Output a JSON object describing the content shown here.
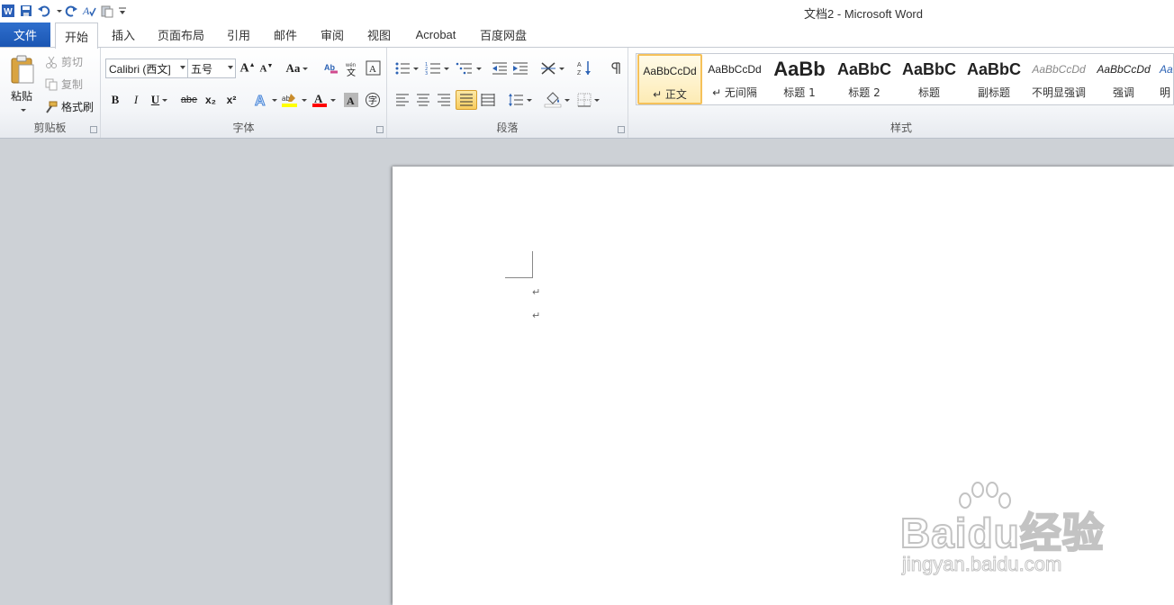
{
  "window": {
    "doc_name": "文档2",
    "separator": " - ",
    "app_name": "Microsoft Word"
  },
  "qat": {
    "icons": [
      "word-logo-icon",
      "save-icon",
      "undo-icon",
      "redo-icon",
      "spelling-icon",
      "paste-icon",
      "customize-qat-icon"
    ]
  },
  "tabs": {
    "file": "文件",
    "items": [
      {
        "label": "开始",
        "active": true
      },
      {
        "label": "插入"
      },
      {
        "label": "页面布局"
      },
      {
        "label": "引用"
      },
      {
        "label": "邮件"
      },
      {
        "label": "审阅"
      },
      {
        "label": "视图"
      },
      {
        "label": "Acrobat"
      },
      {
        "label": "百度网盘"
      }
    ]
  },
  "clipboard": {
    "paste": "粘贴",
    "cut": "剪切",
    "copy": "复制",
    "format_painter": "格式刷",
    "group_label": "剪贴板"
  },
  "font": {
    "font_name": "Calibri (西文]",
    "font_size": "五号",
    "case_label": "Aa",
    "bold": "B",
    "italic": "I",
    "underline": "U",
    "strikethrough": "abe",
    "subscript": "x₂",
    "superscript": "x²",
    "group_label": "字体"
  },
  "paragraph": {
    "group_label": "段落"
  },
  "styles": {
    "group_label": "样式",
    "items": [
      {
        "preview": "AaBbCcDd",
        "name": "↵ 正文"
      },
      {
        "preview": "AaBbCcDd",
        "name": "↵ 无间隔"
      },
      {
        "preview": "AaBb",
        "name": "标题 1"
      },
      {
        "preview": "AaBbC",
        "name": "标题 2"
      },
      {
        "preview": "AaBbC",
        "name": "标题"
      },
      {
        "preview": "AaBbC",
        "name": "副标题"
      },
      {
        "preview": "AaBbCcDd",
        "name": "不明显强调"
      },
      {
        "preview": "AaBbCcDd",
        "name": "强调"
      },
      {
        "preview": "Aa",
        "name": "明"
      }
    ]
  },
  "document": {
    "paragraph_mark": "↵"
  },
  "watermark": {
    "brand": "Baidu经验",
    "url": "jingyan.baidu.com"
  },
  "colors": {
    "file_tab": "#2a66c4",
    "highlight": "#ffff00",
    "font_color": "#ff0000",
    "selected_style_border": "#f5c15a"
  }
}
